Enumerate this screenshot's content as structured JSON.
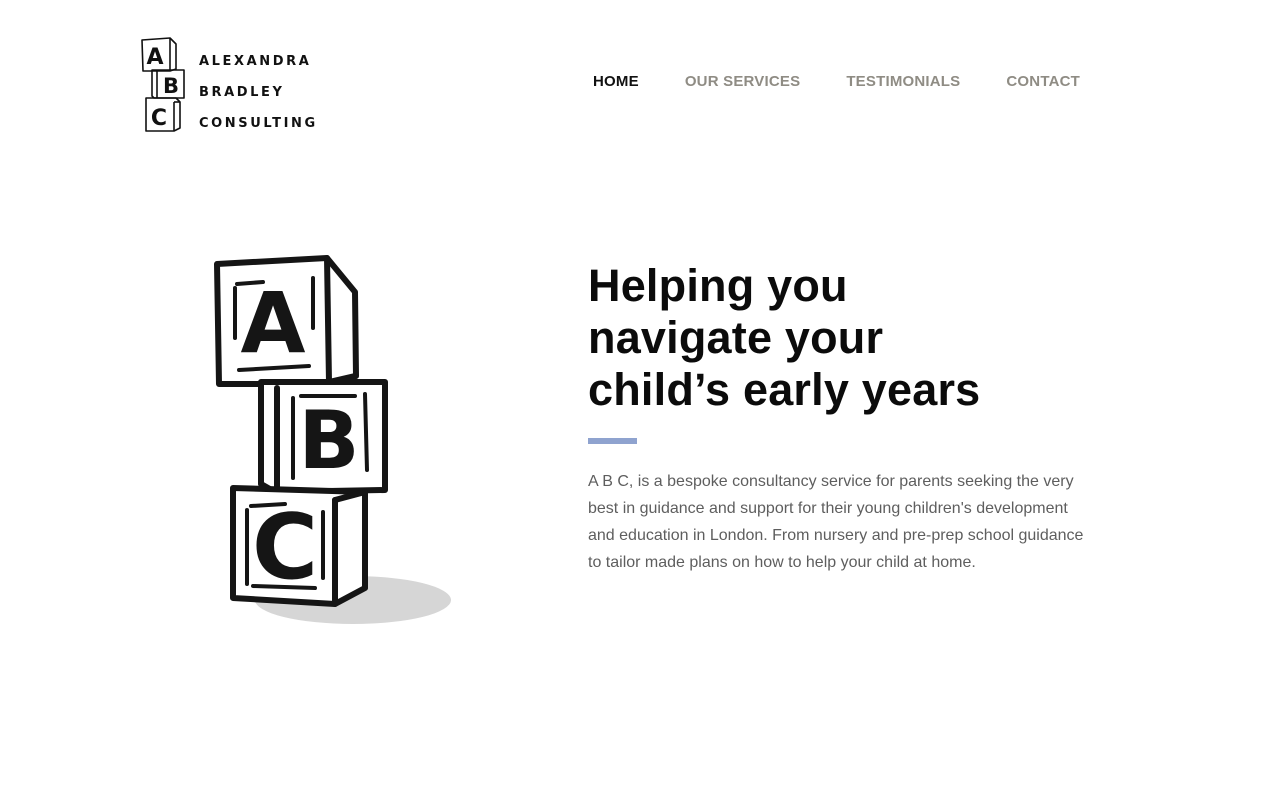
{
  "brand": {
    "lines": [
      "ALEXANDRA",
      "BRADLEY",
      "CONSULTING"
    ],
    "logo_icon": "abc-blocks-icon",
    "block_letters": [
      "A",
      "B",
      "C"
    ]
  },
  "nav": {
    "items": [
      {
        "label": "HOME",
        "active": true
      },
      {
        "label": "OUR SERVICES",
        "active": false
      },
      {
        "label": "TESTIMONIALS",
        "active": false
      },
      {
        "label": "CONTACT",
        "active": false
      }
    ]
  },
  "hero": {
    "headline_lines": [
      "Helping you",
      "navigate your",
      "child’s early years"
    ],
    "intro": "A B C, is a bespoke consultancy service for parents seeking the very best in guidance and support for their young children's development and education in London. From nursery and pre-prep school guidance to tailor made plans on how to help your child at home.",
    "illustration_icon": "abc-blocks-illustration",
    "accent_color": "#8fa3cf"
  },
  "colors": {
    "nav_active": "#111111",
    "nav_inactive": "#8f8c84",
    "body_text": "#5e5e5e"
  }
}
